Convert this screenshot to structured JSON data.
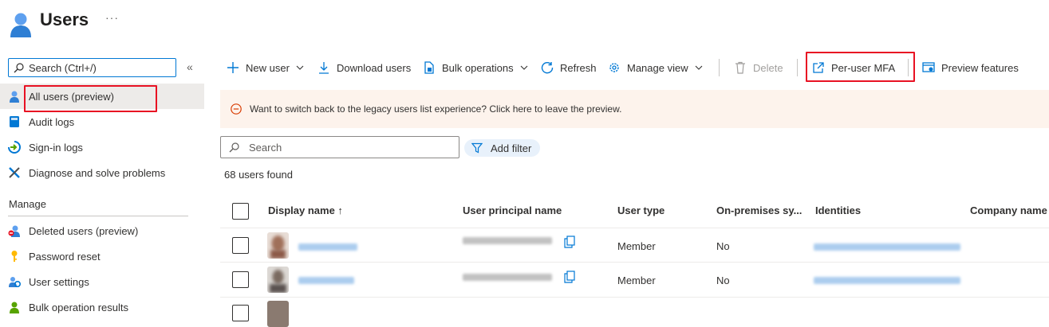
{
  "header": {
    "title": "Users",
    "more": "···"
  },
  "sidebar": {
    "search_placeholder": "Search (Ctrl+/)",
    "collapse": "«",
    "items": [
      {
        "label": "All users (preview)"
      },
      {
        "label": "Audit logs"
      },
      {
        "label": "Sign-in logs"
      },
      {
        "label": "Diagnose and solve problems"
      }
    ],
    "manage_heading": "Manage",
    "manage_items": [
      {
        "label": "Deleted users (preview)"
      },
      {
        "label": "Password reset"
      },
      {
        "label": "User settings"
      },
      {
        "label": "Bulk operation results"
      }
    ]
  },
  "toolbar": {
    "new_user": "New user",
    "download_users": "Download users",
    "bulk_operations": "Bulk operations",
    "refresh": "Refresh",
    "manage_view": "Manage view",
    "delete": "Delete",
    "per_user_mfa": "Per-user MFA",
    "preview_features": "Preview features"
  },
  "banner": {
    "text": "Want to switch back to the legacy users list experience? Click here to leave the preview."
  },
  "search": {
    "placeholder": "Search",
    "add_filter": "Add filter"
  },
  "results": {
    "count_text": "68 users found"
  },
  "table": {
    "columns": [
      "Display name ↑",
      "User principal name",
      "User type",
      "On-premises sy...",
      "Identities",
      "Company name"
    ],
    "rows": [
      {
        "user_type": "Member",
        "on_premises": "No"
      },
      {
        "user_type": "Member",
        "on_premises": "No"
      }
    ]
  },
  "colors": {
    "accent": "#0078d4",
    "highlight": "#e81123",
    "banner_bg": "#fdf3ec",
    "banner_icon": "#d83b01"
  }
}
